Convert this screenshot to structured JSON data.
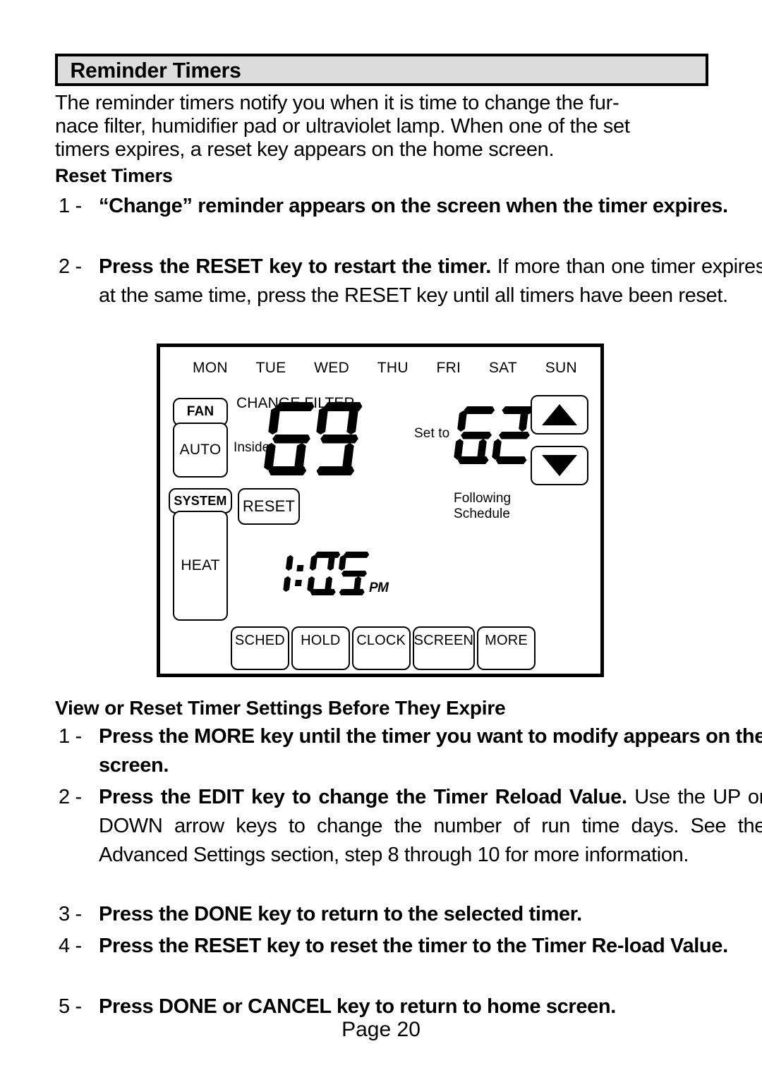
{
  "section": {
    "title": "Reminder Timers"
  },
  "intro": {
    "lines": [
      "The reminder timers notify you when it is time to change the fur-",
      "nace filter, humidifier pad or ultraviolet lamp.  When one of the set",
      "timers expires, a reset key appears on the home screen."
    ]
  },
  "reset_timers": {
    "heading": "Reset Timers",
    "steps": [
      {
        "num": "1 -",
        "bold": "“Change” reminder appears on the screen when the timer expires.",
        "rest": ""
      },
      {
        "num": "2 -",
        "bold": "Press the RESET key to restart the  timer.",
        "rest": " If more than one timer expires at the same time, press the RESET key until all timers have been reset."
      }
    ]
  },
  "view_reset": {
    "heading": "View or Reset Timer Settings Before They Expire",
    "steps": [
      {
        "num": "1 -",
        "bold": "Press the MORE key until the timer you want to modify appears on the screen.",
        "rest": ""
      },
      {
        "num": "2 -",
        "bold": "Press the EDIT key to change the Timer Reload Value.",
        "rest": " Use the UP or DOWN arrow keys to change the number of run time days. See the Advanced Settings section, step 8 through 10 for more information."
      },
      {
        "num": "3 -",
        "bold": "Press the DONE key to return to the selected timer.",
        "rest": ""
      },
      {
        "num": "4 -",
        "bold": "Press the RESET key to reset the timer to the Timer Re-load Value.",
        "rest": ""
      },
      {
        "num": "5 -",
        "bold": "Press DONE or CANCEL key to return to home screen.",
        "rest": ""
      }
    ]
  },
  "thermostat": {
    "days": [
      "MON",
      "TUE",
      "WED",
      "THU",
      "FRI",
      "SAT",
      "SUN"
    ],
    "fan_key": "FAN",
    "fan_mode": "AUTO",
    "system_key": "SYSTEM",
    "system_mode": "HEAT",
    "reset_key": "RESET",
    "alert": "CHANGE FILTER",
    "inside_label": "Inside",
    "inside_temp": "69",
    "setto_label": "Set to",
    "setto_temp": "62",
    "status_line1": "Following",
    "status_line2": "Schedule",
    "time": "1:05",
    "meridiem": "PM",
    "bottom_keys": [
      "SCHED",
      "HOLD",
      "CLOCK",
      "SCREEN",
      "MORE"
    ],
    "up_arrow": "up-arrow",
    "down_arrow": "down-arrow"
  },
  "footer": {
    "page": "Page 20"
  }
}
